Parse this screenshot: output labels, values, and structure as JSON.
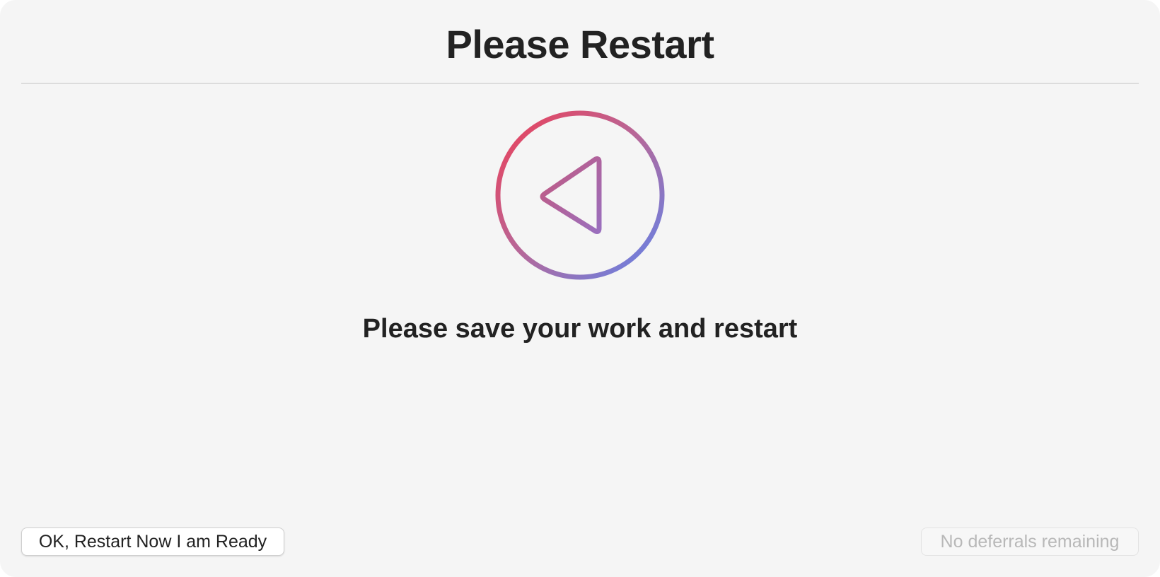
{
  "dialog": {
    "title": "Please Restart",
    "icon": "restart-arrow-icon",
    "message": "Please save your work and restart",
    "buttons": {
      "restart_now": "OK, Restart Now I am Ready",
      "defer": "No deferrals remaining"
    }
  },
  "colors": {
    "window_bg": "#f5f5f5",
    "text": "#222222",
    "icon_gradient_start": "#e8455e",
    "icon_gradient_end": "#6a80e6",
    "disabled_text": "#b8b8b8"
  }
}
